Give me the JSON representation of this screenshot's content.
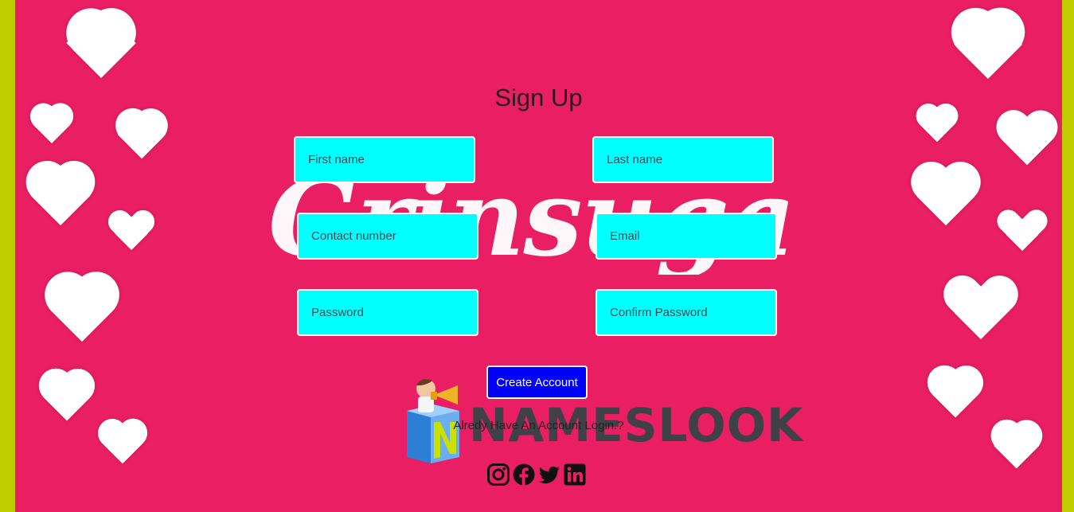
{
  "form": {
    "title": "Sign Up",
    "first_name_placeholder": "First name",
    "last_name_placeholder": "Last name",
    "contact_placeholder": "Contact number",
    "email_placeholder": "Email",
    "password_placeholder": "Password",
    "confirm_password_placeholder": "Confirm Password",
    "submit_label": "Create Account",
    "login_prompt": "Alredy Have An Account Login.?"
  },
  "background": {
    "script_text": "Grinsuga",
    "logo_text": "NAMESLOOK"
  },
  "social": {
    "icons": [
      "instagram-icon",
      "facebook-icon",
      "twitter-icon",
      "linkedin-icon"
    ]
  },
  "colors": {
    "page_border": "#bfcc00",
    "background": "#e91e63",
    "input_fill": "#00ffff",
    "button_fill": "#0000ff",
    "hearts": "#ffffff"
  }
}
